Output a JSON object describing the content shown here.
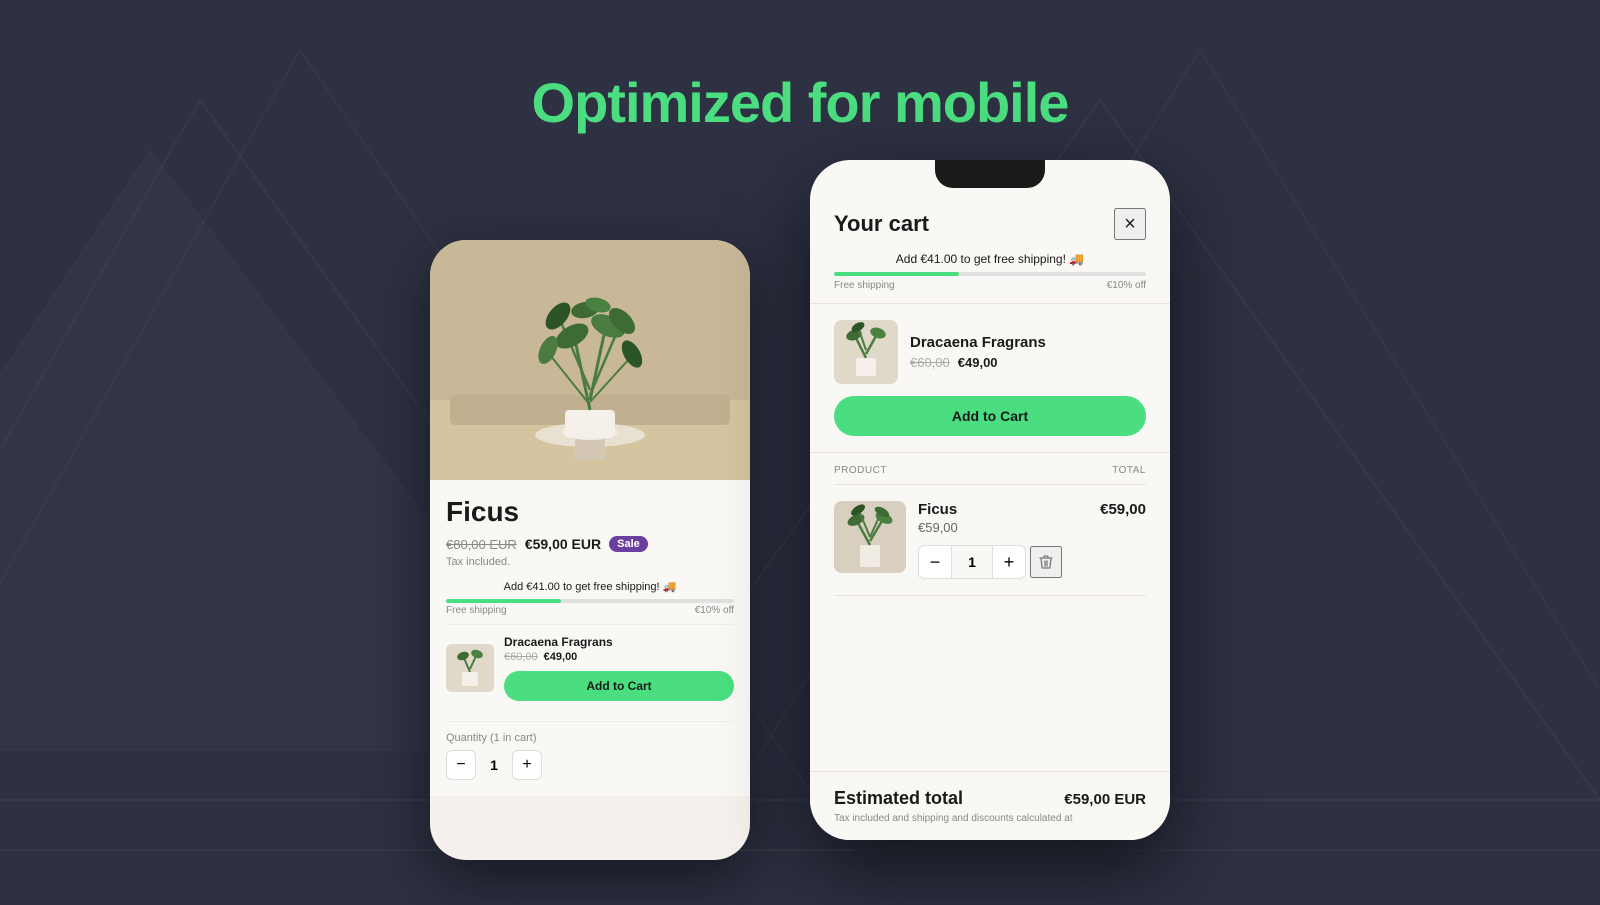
{
  "page": {
    "title": "Optimized for mobile",
    "background_color": "#2d3142",
    "accent_color": "#4ade80"
  },
  "left_phone": {
    "product": {
      "name": "Ficus",
      "price_original": "€80,00 EUR",
      "price_sale": "€59,00 EUR",
      "sale_badge": "Sale",
      "tax_note": "Tax included.",
      "shipping_banner": "Add €41.00 to get free shipping! 🚚",
      "progress_free_shipping": "Free shipping",
      "progress_discount": "€10% off",
      "progress_percent": 40
    },
    "upsell": {
      "name": "Dracaena Fragrans",
      "price_old": "€60,00",
      "price_new": "€49,00",
      "add_to_cart_label": "Add to Cart"
    },
    "quantity": {
      "label": "Quantity (1 in cart)",
      "value": 1
    }
  },
  "right_phone": {
    "cart": {
      "title": "Your cart",
      "close_label": "×",
      "shipping_banner": "Add €41.00 to get free shipping! 🚚",
      "progress_free_shipping": "Free shipping",
      "progress_discount": "€10% off",
      "progress_percent": 40
    },
    "upsell": {
      "name": "Dracaena Fragrans",
      "price_old": "€60,00",
      "price_new": "€49,00",
      "add_to_cart_label": "Add to Cart"
    },
    "table": {
      "col_product": "PRODUCT",
      "col_total": "TOTAL"
    },
    "items": [
      {
        "name": "Ficus",
        "price": "€59,00",
        "total": "€59,00",
        "quantity": 1
      }
    ],
    "footer": {
      "estimated_label": "Estimated total",
      "estimated_value": "€59,00 EUR",
      "note": "Tax included and shipping and discounts calculated at"
    }
  }
}
